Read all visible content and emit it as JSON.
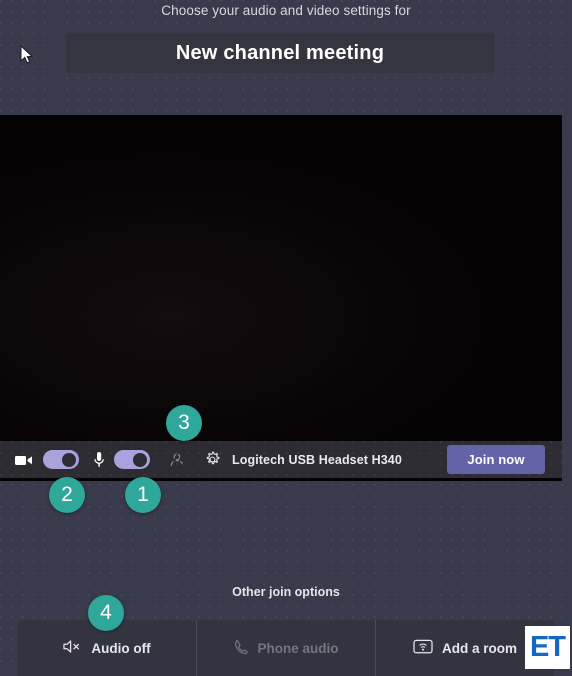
{
  "header": {
    "prompt": "Choose your audio and video settings for",
    "meeting_title": "New channel meeting"
  },
  "controls": {
    "camera_icon": "camera-icon",
    "camera_toggle_state": "on",
    "mic_icon": "microphone-icon",
    "mic_toggle_state": "on",
    "background_filter_icon": "background-blur-icon",
    "settings_icon": "gear-icon",
    "device_name": "Logitech USB Headset H340",
    "join_label": "Join now"
  },
  "other_join": {
    "heading": "Other join options",
    "options": [
      {
        "label": "Audio off",
        "icon": "speaker-muted-icon",
        "disabled": false
      },
      {
        "label": "Phone audio",
        "icon": "phone-icon",
        "disabled": true
      },
      {
        "label": "Add a room",
        "icon": "room-device-icon",
        "disabled": false
      }
    ]
  },
  "badges": [
    {
      "number": "1"
    },
    {
      "number": "2"
    },
    {
      "number": "3"
    },
    {
      "number": "4"
    }
  ],
  "watermark": {
    "text": "ET"
  },
  "colors": {
    "background": "#393a4b",
    "panel": "#33343f",
    "controls_bar": "#2c2c32",
    "accent_purple": "#6264a7",
    "toggle_track": "#a8a2dd",
    "badge_teal": "#2fa79b",
    "logo_blue": "#1567c4"
  }
}
